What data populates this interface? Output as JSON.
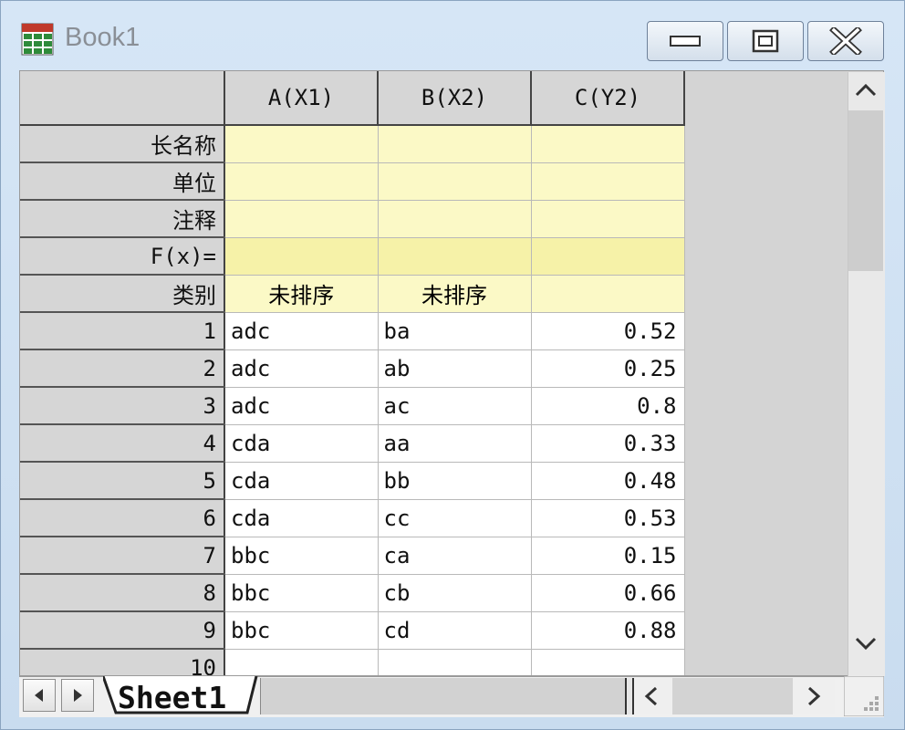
{
  "window": {
    "title": "Book1",
    "controls": [
      "minimize",
      "maximize",
      "close"
    ]
  },
  "columns": [
    "A(X1)",
    "B(X2)",
    "C(Y2)"
  ],
  "header_rows": [
    {
      "label": "长名称",
      "values": [
        "",
        "",
        ""
      ]
    },
    {
      "label": "单位",
      "values": [
        "",
        "",
        ""
      ]
    },
    {
      "label": "注释",
      "values": [
        "",
        "",
        ""
      ]
    },
    {
      "label": "F(x)=",
      "values": [
        "",
        "",
        ""
      ]
    },
    {
      "label": "类别",
      "values": [
        "未排序",
        "未排序",
        ""
      ]
    }
  ],
  "rows": [
    {
      "num": "1",
      "a": "adc",
      "b": "ba",
      "c": "0.52"
    },
    {
      "num": "2",
      "a": "adc",
      "b": "ab",
      "c": "0.25"
    },
    {
      "num": "3",
      "a": "adc",
      "b": "ac",
      "c": "0.8"
    },
    {
      "num": "4",
      "a": "cda",
      "b": "aa",
      "c": "0.33"
    },
    {
      "num": "5",
      "a": "cda",
      "b": "bb",
      "c": "0.48"
    },
    {
      "num": "6",
      "a": "cda",
      "b": "cc",
      "c": "0.53"
    },
    {
      "num": "7",
      "a": "bbc",
      "b": "ca",
      "c": "0.15"
    },
    {
      "num": "8",
      "a": "bbc",
      "b": "cb",
      "c": "0.66"
    },
    {
      "num": "9",
      "a": "bbc",
      "b": "cd",
      "c": "0.88"
    },
    {
      "num": "10",
      "a": "",
      "b": "",
      "c": ""
    }
  ],
  "sheet": {
    "tab_label": "Sheet1"
  },
  "colors": {
    "label_row": "#fbf9c6",
    "header_bg": "#d6d6d6",
    "frame": "#c9dcef"
  }
}
